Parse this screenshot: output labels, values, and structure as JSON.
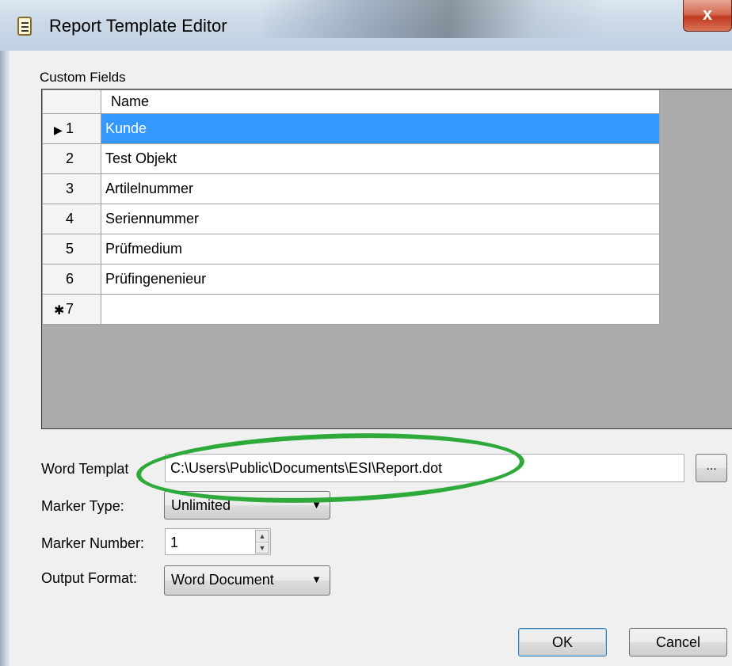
{
  "window": {
    "title": "Report Template Editor",
    "close_glyph": "x"
  },
  "custom_fields": {
    "group_label": "Custom Fields",
    "column_header": "Name",
    "rows": [
      {
        "num": "1",
        "name": "Kunde",
        "selected": true,
        "marker": "▶"
      },
      {
        "num": "2",
        "name": "Test Objekt"
      },
      {
        "num": "3",
        "name": "Artilelnummer"
      },
      {
        "num": "4",
        "name": "Seriennummer"
      },
      {
        "num": "5",
        "name": "Prüfmedium"
      },
      {
        "num": "6",
        "name": "Prüfingenenieur"
      },
      {
        "num": "7",
        "name": "",
        "marker": "✱"
      }
    ]
  },
  "form": {
    "word_template_label": "Word Templat",
    "word_template_value": "C:\\Users\\Public\\Documents\\ESI\\Report.dot",
    "browse_label": "...",
    "marker_type_label": "Marker Type:",
    "marker_type_value": "Unlimited",
    "marker_number_label": "Marker Number:",
    "marker_number_value": "1",
    "output_format_label": "Output Format:",
    "output_format_value": "Word Document"
  },
  "buttons": {
    "ok": "OK",
    "cancel": "Cancel"
  },
  "annotation": {
    "ellipse_color": "#2eaa3a"
  }
}
